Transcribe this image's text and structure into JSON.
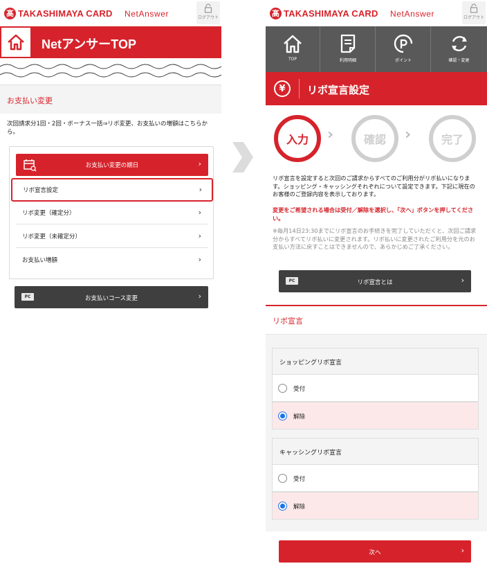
{
  "brand": {
    "name": "TAKASHIMAYA CARD",
    "logo_char": "髙",
    "service": "NetAnswer",
    "logout": "ログアウト"
  },
  "left": {
    "header_title": "NetアンサーTOP",
    "section_title": "お支払い変更",
    "description": "次回請求分1回・2回・ボーナス一括⇒リボ変更、お支払いの増額はこちらから。",
    "menu_head": "お支払い変更の期日",
    "menu_items": [
      {
        "label": "リボ宣言設定"
      },
      {
        "label": "リボ変更（確定分）"
      },
      {
        "label": "リボ変更（未確定分）"
      },
      {
        "label": "お支払い増額"
      }
    ],
    "course_button": {
      "badge": "PC",
      "label": "お支払いコース変更"
    }
  },
  "right": {
    "nav_tabs": [
      {
        "label": "TOP",
        "icon": "home-icon"
      },
      {
        "label": "利用明細",
        "icon": "statement-icon"
      },
      {
        "label": "ポイント",
        "icon": "point-icon"
      },
      {
        "label": "確認・変更",
        "icon": "refresh-icon"
      }
    ],
    "page_title": "リボ宣言設定",
    "yen": "¥",
    "steps": [
      "入力",
      "確認",
      "完了"
    ],
    "desc_main": "リボ宣言を設定すると次回のご請求からすべてのご利用分がリボ払いになります。ショッピング・キャッシングそれぞれについて設定できます。下記に現在のお客様のご登録内容を表示しております。",
    "desc_red": "変更をご希望される場合は受付／解除を選択し、「次へ」ボタンを押してください。",
    "desc_note": "※毎月14日23:30までにリボ宣言のお手続きを完了していただくと、次回ご請求分からすべてリボ払いに変更されます。リボ払いに変更されたご利用分を元のお支払い方法に戻すことはできませんので、あらかじめご了承ください。",
    "about_button": {
      "badge": "PC",
      "label": "リボ宣言とは"
    },
    "section_title": "リボ宣言",
    "groups": [
      {
        "title": "ショッピングリボ宣言",
        "options": [
          {
            "label": "受付",
            "checked": false
          },
          {
            "label": "解除",
            "checked": true
          }
        ]
      },
      {
        "title": "キャッシングリボ宣言",
        "options": [
          {
            "label": "受付",
            "checked": false
          },
          {
            "label": "解除",
            "checked": true
          }
        ]
      }
    ],
    "next_button": "次へ"
  },
  "colors": {
    "brand_red": "#d6232b",
    "nav_gray": "#595959",
    "dark_button": "#3f3f3f",
    "selected_bg": "#fde8e9",
    "radio_blue": "#1a73e8"
  }
}
